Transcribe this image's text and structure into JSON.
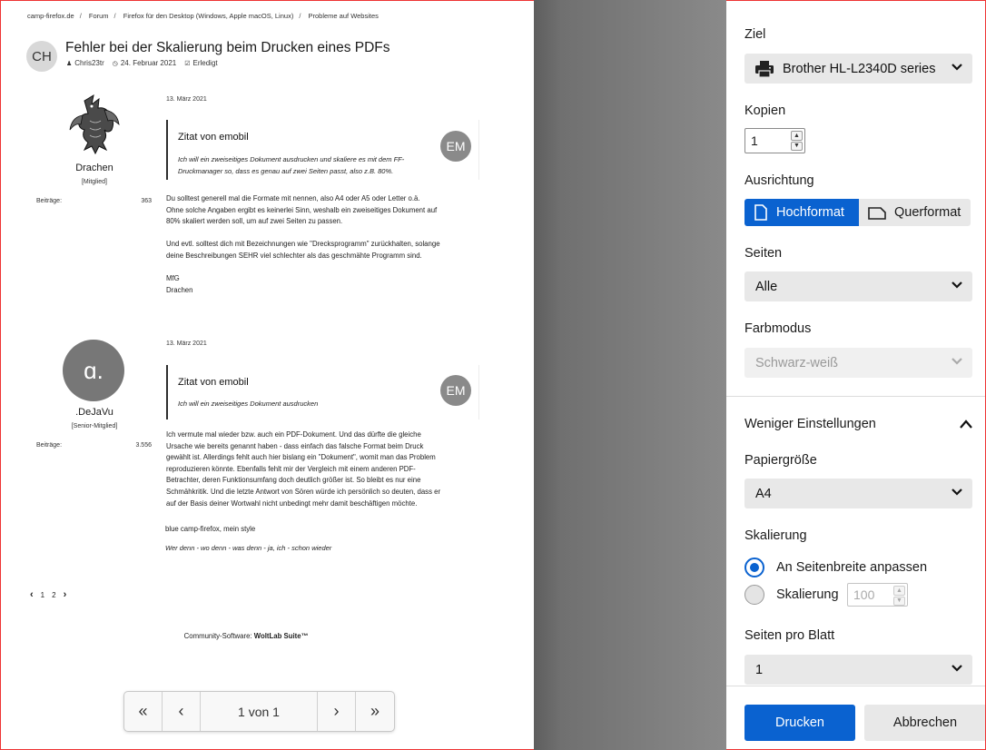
{
  "breadcrumb": [
    "camp-firefox.de",
    "Forum",
    "Firefox für den Desktop (Windows, Apple macOS, Linux)",
    "Probleme auf Websites"
  ],
  "thread": {
    "avatar_initials": "CH",
    "title": "Fehler bei der Skalierung beim Drucken eines PDFs",
    "author": "Chris23tr",
    "date": "24. Februar 2021",
    "status": "Erledigt"
  },
  "posts": [
    {
      "date": "13. März 2021",
      "username": "Drachen",
      "role": "[Mitglied]",
      "count_label": "Beiträge:",
      "count": "363",
      "quote_title": "Zitat von emobil",
      "quote_avatar": "EM",
      "quote_lines": [
        "Ich will ein zweiseitiges Dokument ausdrucken und skaliere es mit dem FF-",
        "Druckmanager so, dass es genau auf zwei Seiten passt, also z.B. 80%."
      ],
      "paragraphs": [
        [
          "Du solltest generell mal die Formate mit nennen, also A4 oder A5 oder Letter o.ä.",
          "Ohne solche Angaben ergibt es keinerlei Sinn, weshalb ein zweiseitiges Dokument auf",
          "80% skaliert werden soll, um auf zwei Seiten zu passen."
        ],
        [
          "Und evtl. solltest dich mit Bezeichnungen wie \"Drecksprogramm\" zurückhalten, solange",
          "deine Beschreibungen SEHR viel schlechter als das geschmähte Programm sind."
        ],
        [
          "MfG",
          "Drachen"
        ]
      ]
    },
    {
      "date": "13. März 2021",
      "avatar_glyph": "ɑ.",
      "username": ".DeJaVu",
      "role": "[Senior-Mitglied]",
      "count_label": "Beiträge:",
      "count": "3.556",
      "quote_title": "Zitat von emobil",
      "quote_avatar": "EM",
      "quote_lines": [
        "Ich will ein zweiseitiges Dokument ausdrucken"
      ],
      "paragraphs": [
        [
          "Ich vermute mal wieder bzw. auch ein PDF-Dokument. Und das dürfte die gleiche",
          "Ursache wie bereits genannt haben - dass einfach das falsche Format beim Druck",
          "gewählt ist. Allerdings fehlt auch hier bislang ein \"Dokument\", womit man das Problem",
          "reproduzieren könnte. Ebenfalls fehlt mir der Vergleich mit einem anderen PDF-",
          "Betrachter, deren Funktionsumfang doch deutlich größer ist. So bleibt es nur eine",
          "Schmähkritik. Und die letzte Antwort von Sören würde ich persönlich so deuten, dass er",
          "auf der Basis deiner Wortwahl nicht unbedingt mehr damit beschäftigen möchte."
        ]
      ],
      "signature_line1": "blue camp-firefox, mein style",
      "signature_line2": "Wer denn - wo denn - was denn - ja, ich - schon wieder"
    }
  ],
  "pagination": {
    "page1": "1",
    "page2": "2"
  },
  "footer": {
    "prefix": "Community-Software: ",
    "brand": "WoltLab Suite™"
  },
  "preview_nav": {
    "page_indicator": "1 von 1"
  },
  "print": {
    "destination_label": "Ziel",
    "destination_value": "Brother HL-L2340D series",
    "copies_label": "Kopien",
    "copies_value": "1",
    "orientation_label": "Ausrichtung",
    "portrait": "Hochformat",
    "landscape": "Querformat",
    "pages_label": "Seiten",
    "pages_value": "Alle",
    "color_label": "Farbmodus",
    "color_value": "Schwarz-weiß",
    "less_settings": "Weniger Einstellungen",
    "paper_label": "Papiergröße",
    "paper_value": "A4",
    "scaling_label": "Skalierung",
    "scaling_fit": "An Seitenbreite anpassen",
    "scaling_custom": "Skalierung",
    "scaling_value": "100",
    "pps_label": "Seiten pro Blatt",
    "pps_value": "1",
    "print_button": "Drucken",
    "cancel_button": "Abbrechen"
  },
  "colors": {
    "accent": "#0a62d0"
  }
}
